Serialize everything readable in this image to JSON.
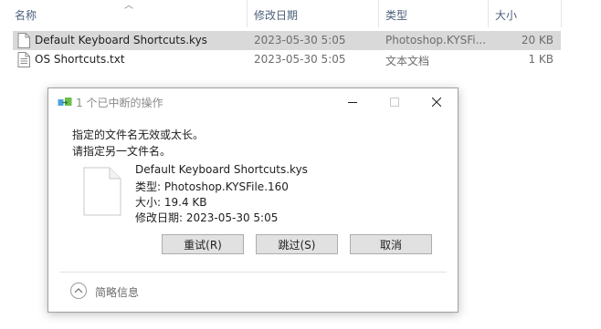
{
  "columns": {
    "name": "名称",
    "date": "修改日期",
    "type": "类型",
    "size": "大小"
  },
  "files": [
    {
      "name": "Default Keyboard Shortcuts.kys",
      "date": "2023-05-30 5:05",
      "type": "Photoshop.KYSFi...",
      "size": "20 KB",
      "selected": true
    },
    {
      "name": "OS Shortcuts.txt",
      "date": "2023-05-30 5:05",
      "type": "文本文档",
      "size": "1 KB",
      "selected": false
    }
  ],
  "dialog": {
    "title": "1 个已中断的操作",
    "message_line1": "指定的文件名无效或太长。",
    "message_line2": "请指定另一文件名。",
    "file_name": "Default Keyboard Shortcuts.kys",
    "file_type": "类型: Photoshop.KYSFile.160",
    "file_size": "大小: 19.4 KB",
    "file_date": "修改日期: 2023-05-30 5:05",
    "buttons": {
      "retry": "重试(R)",
      "skip": "跳过(S)",
      "cancel": "取消"
    },
    "details_label": "简略信息"
  },
  "icons": {
    "sort": "sort-caret-up-icon",
    "file": "file-icon",
    "document": "document-icon",
    "title": "file-move-icon",
    "minimize": "minimize-icon",
    "maximize": "maximize-icon",
    "close": "close-icon",
    "collapse": "chevron-up-icon"
  },
  "colors": {
    "header_text": "#4c607a",
    "selected_row": "#d9d9d9",
    "button_face": "#e1e1e1",
    "button_border": "#adadad"
  }
}
